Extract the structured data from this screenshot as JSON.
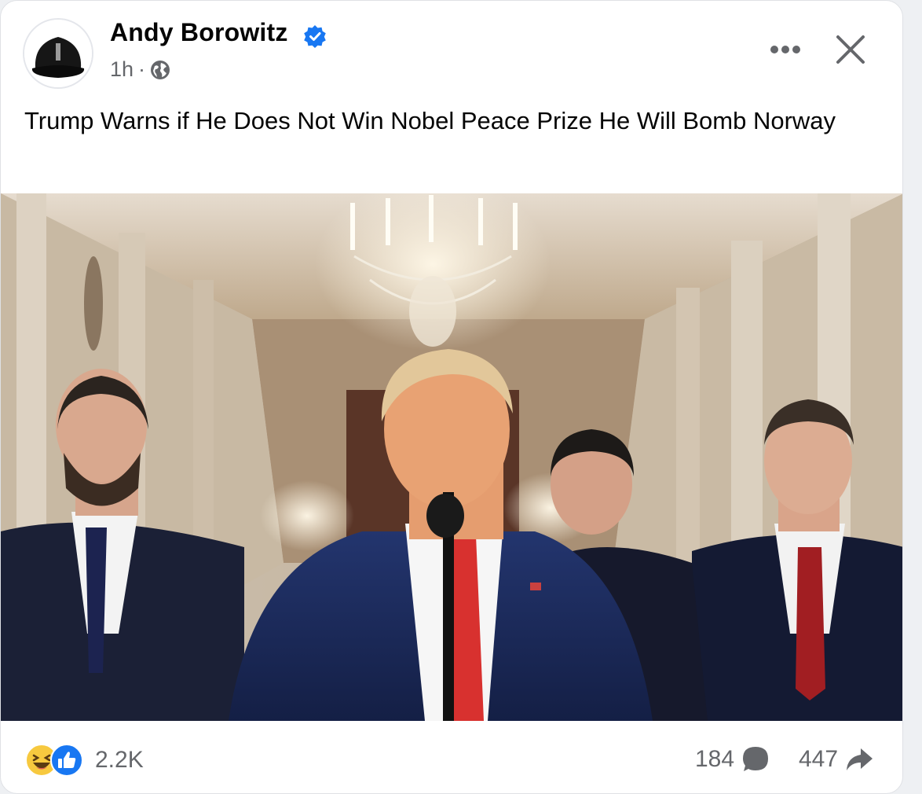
{
  "post": {
    "author": "Andy Borowitz",
    "verified": true,
    "time": "1h",
    "separator": "·",
    "audience_icon": "globe-icon",
    "text": "Trump Warns if He Does Not Win Nobel Peace Prize He Will Bomb Norway",
    "more_icon": "more-options-icon",
    "close_icon": "close-icon"
  },
  "stats": {
    "reaction_icons": [
      "haha-reaction-icon",
      "like-reaction-icon"
    ],
    "reactions_count": "2.2K",
    "comments_count": "184",
    "shares_count": "447"
  },
  "colors": {
    "verified_blue": "#1877f2",
    "meta_gray": "#65676b",
    "text_black": "#050505",
    "haha_yellow": "#f7c93f",
    "like_blue": "#1877f2"
  }
}
